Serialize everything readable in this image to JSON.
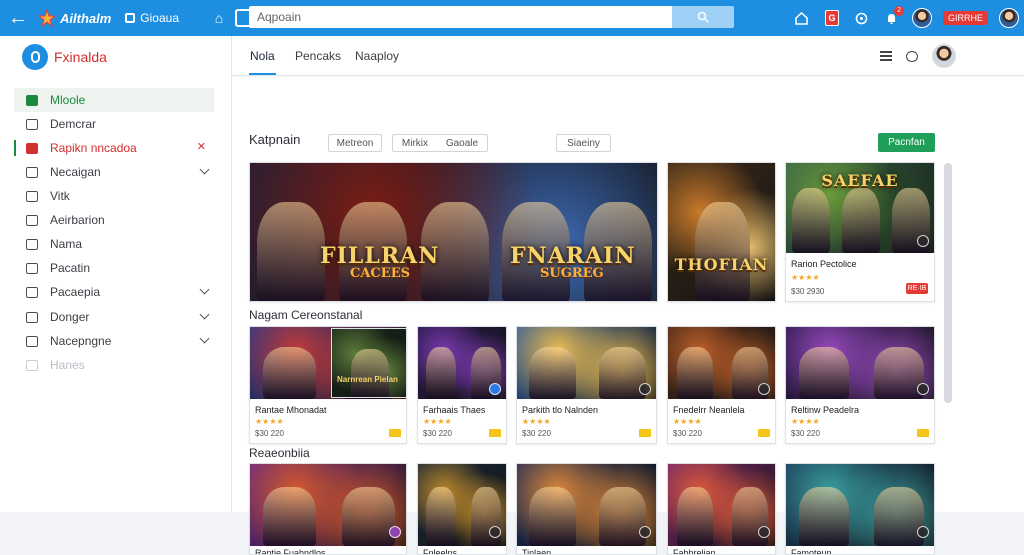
{
  "topbar": {
    "logo_text": "Ailthalm",
    "store_label": "Gioaua",
    "search": {
      "value": "Aqpoain"
    },
    "badge_count": "2",
    "notif_box": "G",
    "pill_label": "GIRRHE"
  },
  "sidebar": {
    "brand": "Fxinalda",
    "items": [
      {
        "label": "Mloole",
        "state": "active"
      },
      {
        "label": "Demcrar"
      },
      {
        "label": "Rapikn nncadoa",
        "state": "red",
        "mark": "✕"
      },
      {
        "label": "Necaigan",
        "chevron": true
      },
      {
        "label": "Vitk"
      },
      {
        "label": "Aeirbarion"
      },
      {
        "label": "Nama"
      },
      {
        "label": "Pacatin"
      },
      {
        "label": "Pacaepia",
        "chevron": true
      },
      {
        "label": "Donger",
        "chevron": true
      },
      {
        "label": "Nacepngne",
        "chevron": true
      },
      {
        "label": "Hanes",
        "state": "muted"
      }
    ]
  },
  "main": {
    "tabs": [
      {
        "label": "Nola",
        "active": true
      },
      {
        "label": "Pencaks"
      },
      {
        "label": "Naaploy"
      }
    ],
    "section1": {
      "title": "Katpnain",
      "filters": [
        "Metreon",
        "Mirkix",
        "Gaoale",
        "Siaeiny"
      ],
      "action_button": "Pacnfan"
    },
    "featured": [
      {
        "title": "FILLRAN",
        "subtitle": "CACEES",
        "palette": [
          "#1b1f3a",
          "#7a1d14",
          "#3d6ab3"
        ]
      },
      {
        "title": "FNARAIN",
        "subtitle": "SUGREG",
        "palette": [
          "#2a1d3a",
          "#c95a1b",
          "#5b2a6a"
        ]
      }
    ],
    "side_feature_1": {
      "title": "THOFIAN",
      "palette": [
        "#3a2a1a",
        "#c97a2a",
        "#e8c070"
      ]
    },
    "side_feature_2": {
      "title": "SAEFAE",
      "name": "Rarion Pectolice",
      "rating": "★★★★",
      "price": "$30 2930",
      "tag": "RE·IB",
      "palette": [
        "#3a6a4a",
        "#6a9a3a",
        "#2a4a2a"
      ]
    },
    "section2": {
      "title": "Nagam Cereonstanal",
      "cards": [
        {
          "name": "Rantae Mhonadat",
          "rating": "★★★★",
          "price": "$30 220",
          "palette": [
            "#2a3a8a",
            "#c43a3a"
          ]
        },
        {
          "name": "Narnrean Pielan",
          "rating": "★★★★",
          "price": "$30 220",
          "palette": [
            "#1a2a1a",
            "#5a7a3a"
          ]
        },
        {
          "name": "Farhaais Thaes",
          "rating": "★★★★",
          "price": "$30 220",
          "palette": [
            "#2a1a4a",
            "#7a3ab0"
          ]
        },
        {
          "name": "Parkith tlo Nalnden",
          "rating": "★★★★",
          "price": "$30 220",
          "palette": [
            "#2a5aa0",
            "#f0c050"
          ]
        },
        {
          "name": "Fnedelrr Neanlela",
          "rating": "★★★★",
          "price": "$30 220",
          "palette": [
            "#4a2a1a",
            "#c0602a"
          ]
        },
        {
          "name": "Reltinw Peadelra",
          "rating": "★★★★",
          "price": "$30 220",
          "palette": [
            "#2a1a4a",
            "#9a4ac0"
          ]
        }
      ]
    },
    "section3": {
      "title": "Reaeonbiia",
      "cards": [
        {
          "name": "Rantie Fuahndlos",
          "palette": [
            "#6a2a8a",
            "#d85a2a"
          ]
        },
        {
          "name": "Fnleelns",
          "palette": [
            "#1a2a3a",
            "#c08a2a"
          ]
        },
        {
          "name": "Tinlaen",
          "palette": [
            "#1a2a5a",
            "#e08a3a"
          ]
        },
        {
          "name": "Fabhrelian",
          "palette": [
            "#7a2a6a",
            "#e05a3a"
          ]
        },
        {
          "name": "Famoteun",
          "palette": [
            "#1a3a5a",
            "#3aa0a0"
          ]
        }
      ]
    }
  }
}
